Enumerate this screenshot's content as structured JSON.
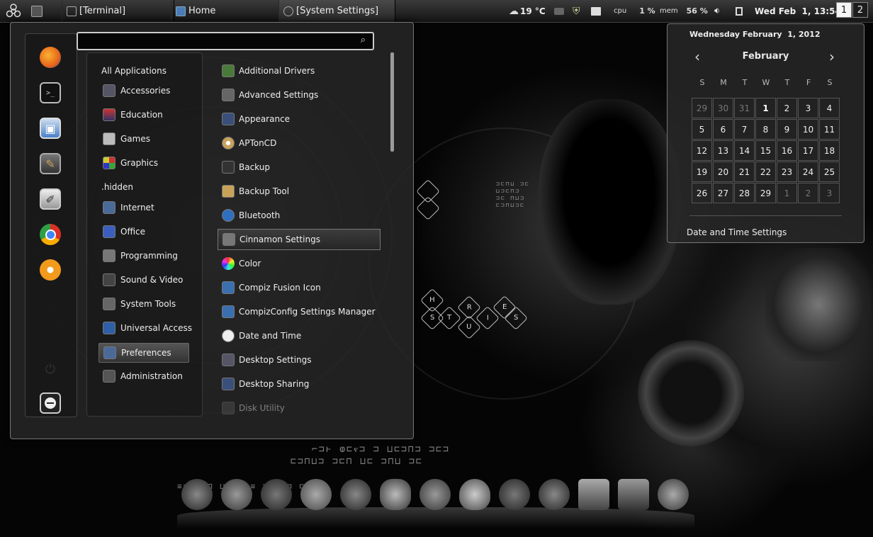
{
  "colors": {
    "panel": "#1f1f1f",
    "accent": "#ffffff",
    "firefox": "#e8651a",
    "chrome": "#2f9e44"
  },
  "top_panel": {
    "menu_icon": "biohazard-icon",
    "tasks": [
      {
        "label": "[Terminal]",
        "icon": "terminal-icon"
      },
      {
        "label": "Home",
        "icon": "home-folder-icon"
      },
      {
        "label": "[System Settings]",
        "icon": "settings-icon"
      }
    ],
    "weather": "19 °C",
    "cpu_label": "cpu",
    "cpu_value": "1 %",
    "mem_label": "mem",
    "mem_value": "56 %",
    "clock": "Wed Feb  1, 13:54",
    "workspaces": [
      "1",
      "2"
    ],
    "active_workspace": "1"
  },
  "menu": {
    "search_value": "",
    "favorites": [
      "firefox-icon",
      "terminal-icon",
      "file-manager-icon",
      "gimp-icon",
      "text-editor-icon",
      "chrome-icon",
      "cd-burner-icon",
      "logout-icon"
    ],
    "categories": [
      "All Applications",
      "Accessories",
      "Education",
      "Games",
      "Graphics",
      ".hidden",
      "Internet",
      "Office",
      "Programming",
      "Sound & Video",
      "System Tools",
      "Universal Access",
      "Preferences",
      "Administration"
    ],
    "selected_category": "Preferences",
    "apps": [
      "Additional Drivers",
      "Advanced Settings",
      "Appearance",
      "APTonCD",
      "Backup",
      "Backup Tool",
      "Bluetooth",
      "Cinnamon Settings",
      "Color",
      "Compiz Fusion Icon",
      "CompizConfig Settings Manager",
      "Date and Time",
      "Desktop Settings",
      "Desktop Sharing",
      "Disk Utility"
    ],
    "selected_app": "Cinnamon Settings"
  },
  "calendar": {
    "date_header": "Wednesday February  1, 2012",
    "month": "February",
    "weekdays": [
      "S",
      "M",
      "T",
      "W",
      "T",
      "F",
      "S"
    ],
    "weeks": [
      [
        "29",
        "30",
        "31",
        "1",
        "2",
        "3",
        "4"
      ],
      [
        "5",
        "6",
        "7",
        "8",
        "9",
        "10",
        "11"
      ],
      [
        "12",
        "13",
        "14",
        "15",
        "16",
        "17",
        "18"
      ],
      [
        "19",
        "20",
        "21",
        "22",
        "23",
        "24",
        "25"
      ],
      [
        "26",
        "27",
        "28",
        "29",
        "1",
        "2",
        "3"
      ]
    ],
    "settings_label": "Date and Time Settings"
  },
  "desktop": {
    "hex_letters": [
      "H",
      "S",
      "T",
      "R",
      "I",
      "E",
      "S",
      "U"
    ]
  }
}
